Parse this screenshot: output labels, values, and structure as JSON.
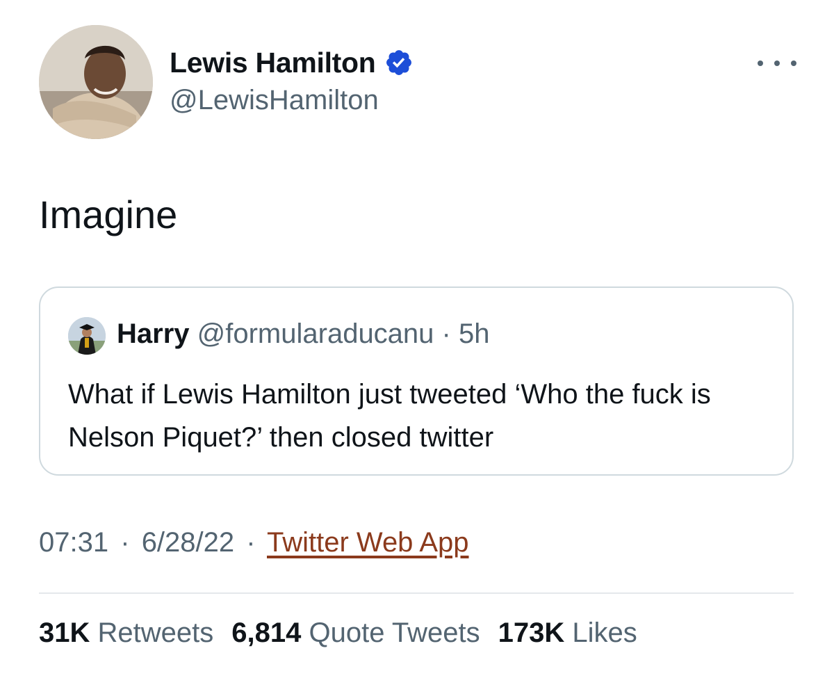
{
  "author": {
    "name": "Lewis Hamilton",
    "handle": "@LewisHamilton",
    "verified": true
  },
  "tweet": {
    "text": "Imagine"
  },
  "quoted_tweet": {
    "name": "Harry",
    "handle": "@formularaducanu",
    "separator": "·",
    "age": "5h",
    "text": "What if Lewis Hamilton just tweeted ‘Who the fuck is Nelson Piquet?’ then closed twitter"
  },
  "meta": {
    "time": "07:31",
    "date": "6/28/22",
    "separator": "·",
    "source": "Twitter Web App"
  },
  "stats": {
    "retweets_count": "31K",
    "retweets_label": "Retweets",
    "quotes_count": "6,814",
    "quotes_label": "Quote Tweets",
    "likes_count": "173K",
    "likes_label": "Likes"
  },
  "colors": {
    "verified_badge": "#1d4ed8",
    "source_link": "#8b3a1c",
    "secondary_text": "#536471",
    "border": "#cfd9de"
  },
  "icons": {
    "verified": "verified-badge-icon",
    "more": "more-options-icon"
  }
}
